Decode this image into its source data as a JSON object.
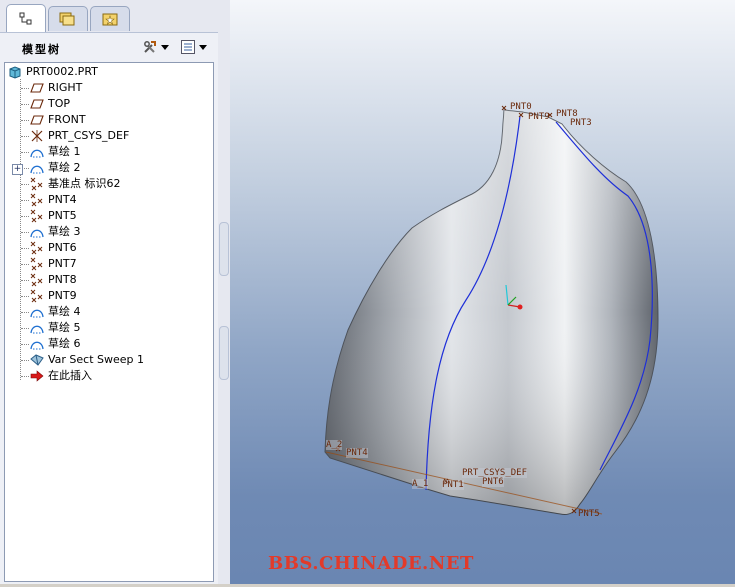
{
  "model_tree": {
    "title": "模型树",
    "items": [
      {
        "label": "PRT0002.PRT",
        "icon": "part-icon"
      },
      {
        "label": "RIGHT",
        "icon": "datum-plane-icon"
      },
      {
        "label": "TOP",
        "icon": "datum-plane-icon"
      },
      {
        "label": "FRONT",
        "icon": "datum-plane-icon"
      },
      {
        "label": "PRT_CSYS_DEF",
        "icon": "coordinate-system-icon"
      },
      {
        "label": "草绘 1",
        "icon": "sketch-icon"
      },
      {
        "label": "草绘 2",
        "icon": "sketch-icon"
      },
      {
        "label": "基准点 标识62",
        "icon": "datum-point-icon"
      },
      {
        "label": "PNT4",
        "icon": "datum-point-icon"
      },
      {
        "label": "PNT5",
        "icon": "datum-point-icon"
      },
      {
        "label": "草绘 3",
        "icon": "sketch-icon"
      },
      {
        "label": "PNT6",
        "icon": "datum-point-icon"
      },
      {
        "label": "PNT7",
        "icon": "datum-point-icon"
      },
      {
        "label": "PNT8",
        "icon": "datum-point-icon"
      },
      {
        "label": "PNT9",
        "icon": "datum-point-icon"
      },
      {
        "label": "草绘 4",
        "icon": "sketch-icon"
      },
      {
        "label": "草绘 5",
        "icon": "sketch-icon"
      },
      {
        "label": "草绘 6",
        "icon": "sketch-icon"
      },
      {
        "label": "Var Sect Sweep 1",
        "icon": "var-sect-sweep-icon"
      },
      {
        "label": "在此插入",
        "icon": "insert-here-arrow-icon"
      }
    ]
  },
  "viewport": {
    "labels": {
      "pnt0": "PNT0",
      "pnt9": "PNT9",
      "pnt8": "PNT8",
      "pnt3": "PNT3",
      "a2": "A_2",
      "pnt4": "PNT4",
      "pnt1": "PNT1",
      "a1": "A_1",
      "csys": "PRT_CSYS_DEF",
      "pnt6": "PNT6",
      "pnt5": "PNT5"
    },
    "watermark": "BBS.CHINADE.NET"
  },
  "colors": {
    "datum_label": "#6b2a0c",
    "curve": "#1e2fd8",
    "watermark": "#e23a2a",
    "tree_border": "#8d9ab3"
  }
}
